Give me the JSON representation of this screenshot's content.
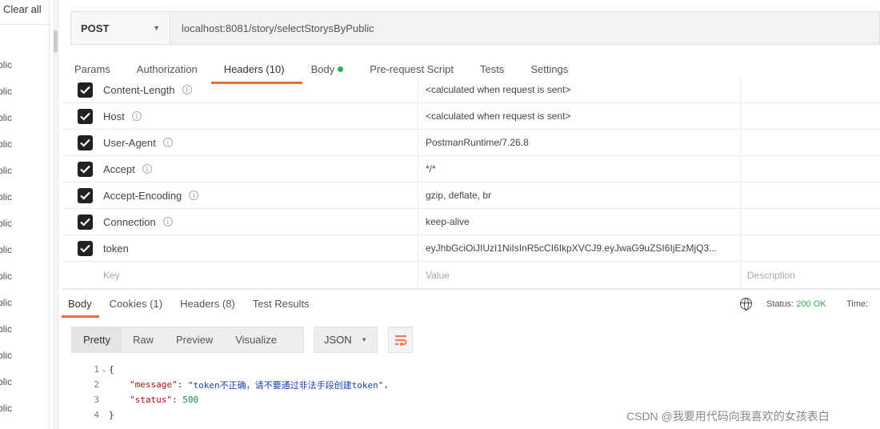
{
  "sidebar": {
    "clear_all": "Clear all",
    "items": [
      "blic",
      "blic",
      "blic",
      "blic",
      "blic",
      "blic",
      "blic",
      "blic",
      "blic",
      "blic",
      "blic",
      "blic",
      "blic",
      "blic"
    ]
  },
  "request": {
    "method": "POST",
    "url": "localhost:8081/story/selectStorysByPublic"
  },
  "request_tabs": {
    "params": "Params",
    "authorization": "Authorization",
    "headers": "Headers (10)",
    "body": "Body",
    "pre_request": "Pre-request Script",
    "tests": "Tests",
    "settings": "Settings"
  },
  "headers": [
    {
      "key": "Content-Length",
      "value": "<calculated when request is sent>"
    },
    {
      "key": "Host",
      "value": "<calculated when request is sent>"
    },
    {
      "key": "User-Agent",
      "value": "PostmanRuntime/7.26.8"
    },
    {
      "key": "Accept",
      "value": "*/*"
    },
    {
      "key": "Accept-Encoding",
      "value": "gzip, deflate, br"
    },
    {
      "key": "Connection",
      "value": "keep-alive"
    },
    {
      "key": "token",
      "value": "eyJhbGciOiJIUzI1NiIsInR5cCI6IkpXVCJ9.eyJwaG9uZSI6IjEzMjQ3..."
    }
  ],
  "header_placeholders": {
    "key": "Key",
    "value": "Value",
    "description": "Description"
  },
  "response_tabs": {
    "body": "Body",
    "cookies": "Cookies (1)",
    "headers": "Headers (8)",
    "test_results": "Test Results"
  },
  "response_status": {
    "label": "Status:",
    "value": "200 OK",
    "time_label": "Time:"
  },
  "view_modes": {
    "pretty": "Pretty",
    "raw": "Raw",
    "preview": "Preview",
    "visualize": "Visualize"
  },
  "format": "JSON",
  "code": {
    "line1": "1",
    "line2": "2",
    "line3": "3",
    "line4": "4",
    "open_brace": "{",
    "close_brace": "}",
    "message_key": "\"message\"",
    "message_value": "\"token不正确，请不要通过非法手段创建token\"",
    "status_key": "\"status\"",
    "status_value": "500"
  },
  "watermark": "CSDN @我要用代码向我喜欢的女孩表白",
  "colors": {
    "accent": "#f26b3a",
    "success": "#2bb24c"
  }
}
